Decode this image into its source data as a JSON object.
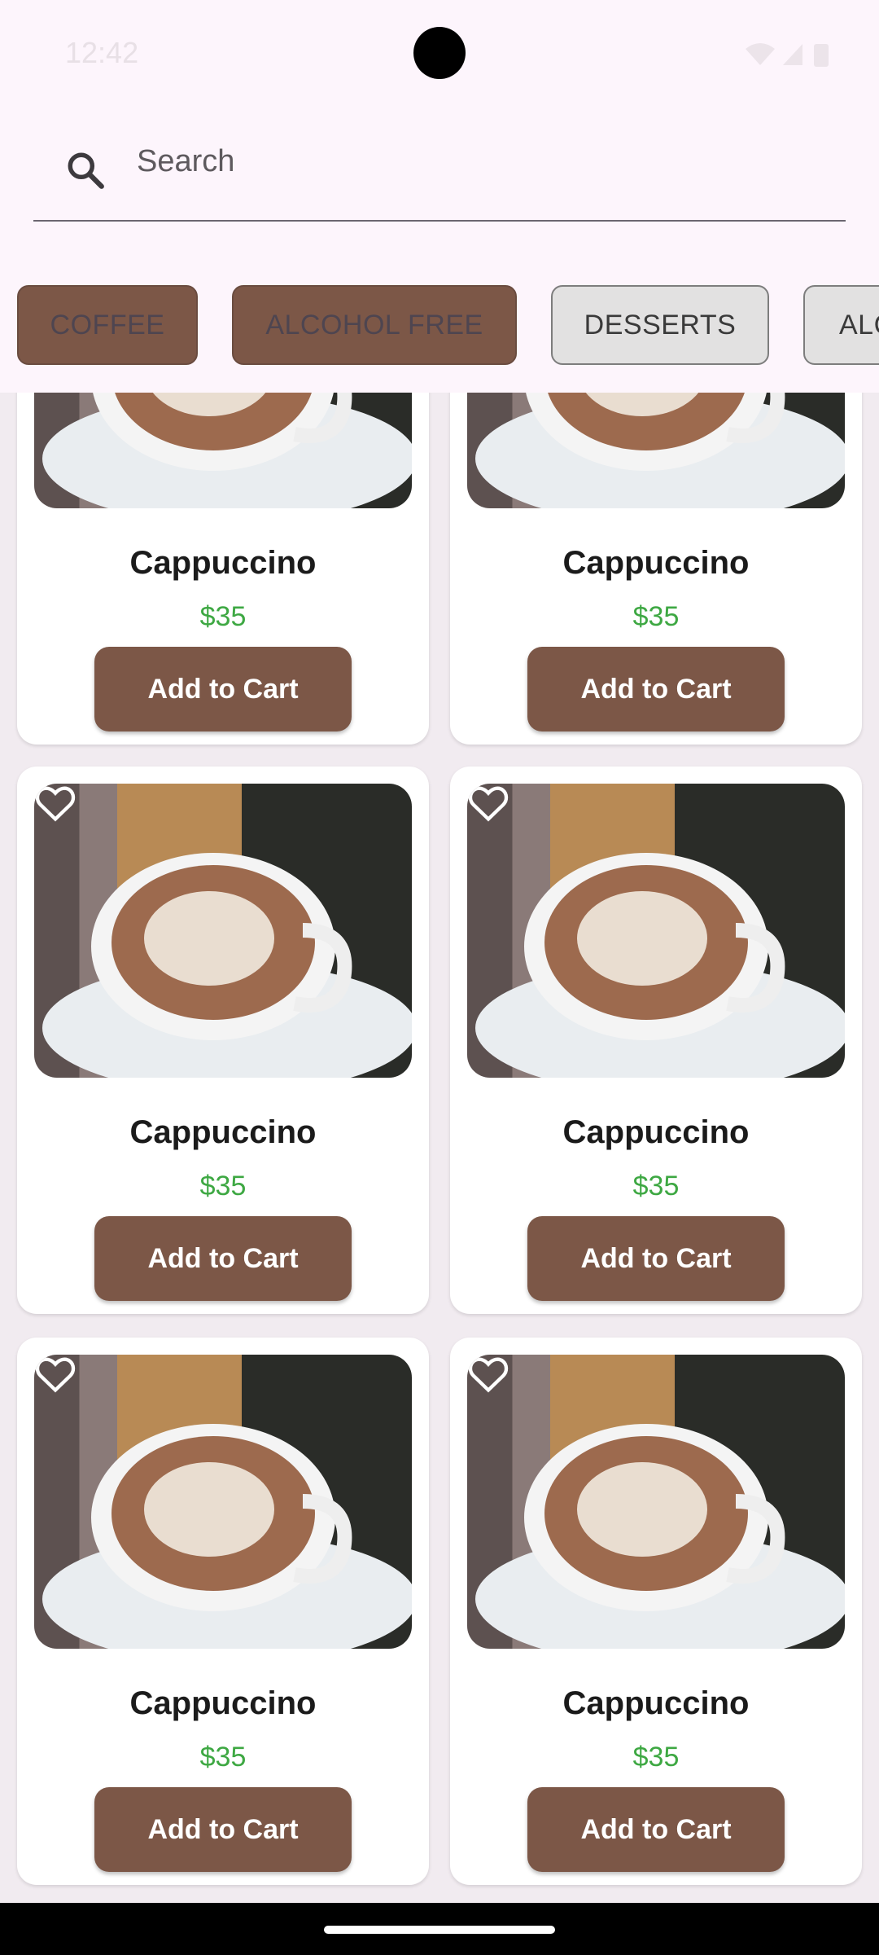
{
  "status_bar": {
    "time": "12:42"
  },
  "search": {
    "placeholder": "Search"
  },
  "categories": [
    {
      "label": "COFFEE"
    },
    {
      "label": "ALCOHOL FREE"
    },
    {
      "label": "DESSERTS"
    },
    {
      "label": "ALC"
    }
  ],
  "products": [
    {
      "name": "Cappuccino",
      "price": "$35",
      "button": "Add to Cart"
    },
    {
      "name": "Cappuccino",
      "price": "$35",
      "button": "Add to Cart"
    },
    {
      "name": "Cappuccino",
      "price": "$35",
      "button": "Add to Cart"
    },
    {
      "name": "Cappuccino",
      "price": "$35",
      "button": "Add to Cart"
    },
    {
      "name": "Cappuccino",
      "price": "$35",
      "button": "Add to Cart"
    },
    {
      "name": "Cappuccino",
      "price": "$35",
      "button": "Add to Cart"
    }
  ],
  "colors": {
    "accent": "#7c5747",
    "price": "#3ea843",
    "header_bg": "#fdf5fc"
  }
}
